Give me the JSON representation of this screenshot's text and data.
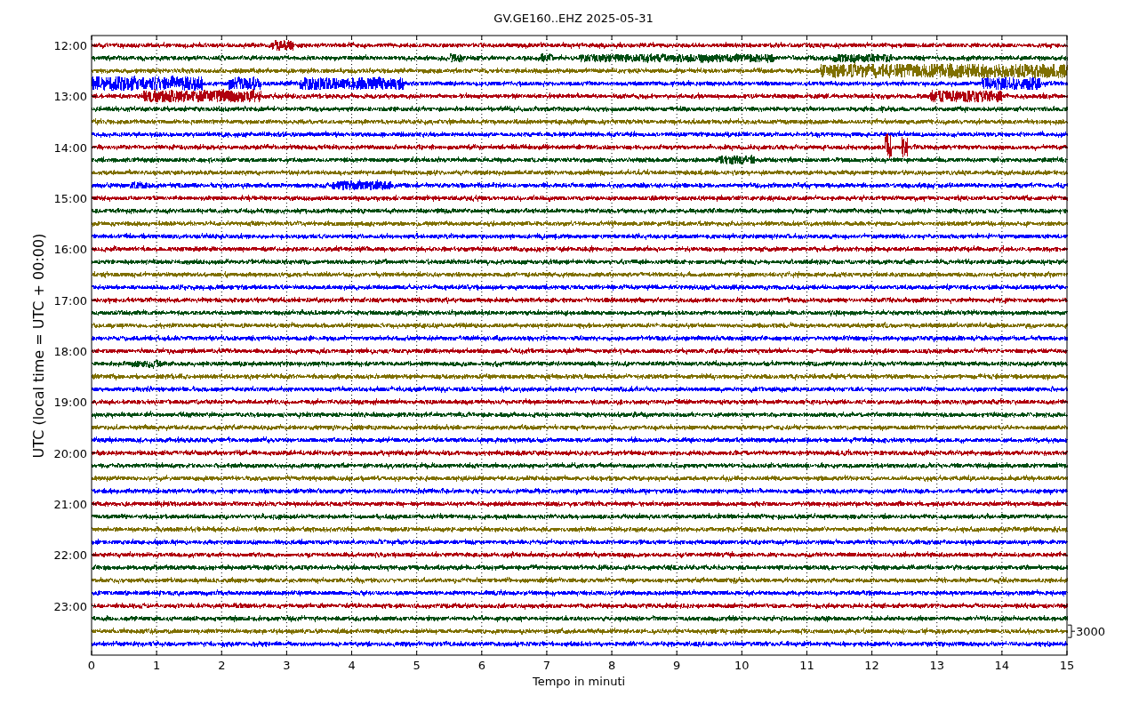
{
  "title": "GV.GE160..EHZ 2025-05-31",
  "ylabel": "UTC (local time = UTC + 00:00)",
  "xlabel": "Tempo in minuti",
  "x_ticks": [
    "0",
    "1",
    "2",
    "3",
    "4",
    "5",
    "6",
    "7",
    "8",
    "9",
    "10",
    "11",
    "12",
    "13",
    "14",
    "15"
  ],
  "y_ticks": [
    "12:00",
    "13:00",
    "14:00",
    "15:00",
    "16:00",
    "17:00",
    "18:00",
    "19:00",
    "20:00",
    "21:00",
    "22:00",
    "23:00"
  ],
  "scale_label": "3000",
  "traces": [
    {
      "color": "#b0000f"
    },
    {
      "color": "#004d12"
    },
    {
      "color": "#7f7000"
    },
    {
      "color": "#0000ff"
    },
    {
      "color": "#b0000f"
    },
    {
      "color": "#004d12"
    },
    {
      "color": "#7f7000"
    },
    {
      "color": "#0000ff"
    },
    {
      "color": "#b0000f"
    },
    {
      "color": "#004d12"
    },
    {
      "color": "#7f7000"
    },
    {
      "color": "#0000ff"
    },
    {
      "color": "#b0000f"
    },
    {
      "color": "#004d12"
    },
    {
      "color": "#7f7000"
    },
    {
      "color": "#0000ff"
    },
    {
      "color": "#b0000f"
    },
    {
      "color": "#004d12"
    },
    {
      "color": "#7f7000"
    },
    {
      "color": "#0000ff"
    },
    {
      "color": "#b0000f"
    },
    {
      "color": "#004d12"
    },
    {
      "color": "#7f7000"
    },
    {
      "color": "#0000ff"
    },
    {
      "color": "#b0000f"
    },
    {
      "color": "#004d12"
    },
    {
      "color": "#7f7000"
    },
    {
      "color": "#0000ff"
    },
    {
      "color": "#b0000f"
    },
    {
      "color": "#004d12"
    },
    {
      "color": "#7f7000"
    },
    {
      "color": "#0000ff"
    },
    {
      "color": "#b0000f"
    },
    {
      "color": "#004d12"
    },
    {
      "color": "#7f7000"
    },
    {
      "color": "#0000ff"
    },
    {
      "color": "#b0000f"
    },
    {
      "color": "#004d12"
    },
    {
      "color": "#7f7000"
    },
    {
      "color": "#0000ff"
    },
    {
      "color": "#b0000f"
    },
    {
      "color": "#004d12"
    },
    {
      "color": "#7f7000"
    },
    {
      "color": "#0000ff"
    },
    {
      "color": "#b0000f"
    },
    {
      "color": "#004d12"
    },
    {
      "color": "#7f7000"
    },
    {
      "color": "#0000ff"
    }
  ]
}
